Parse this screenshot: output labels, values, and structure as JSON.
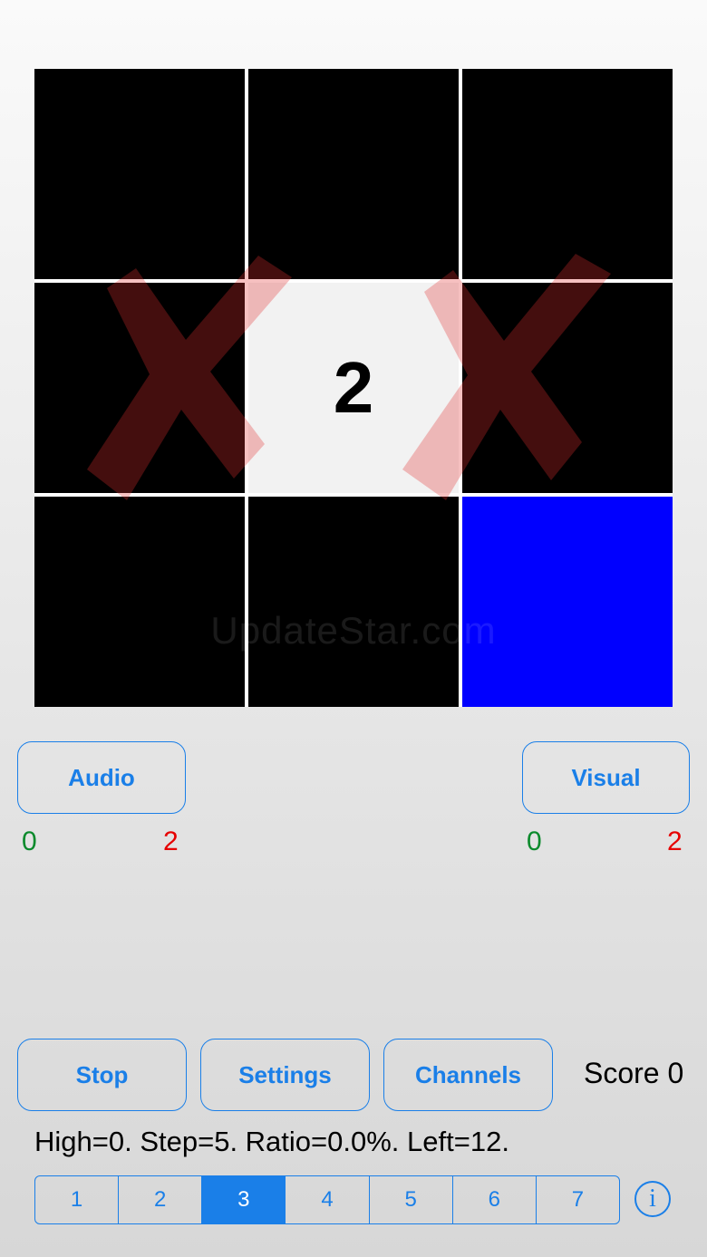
{
  "board": {
    "cells": [
      {
        "state": "off",
        "label": ""
      },
      {
        "state": "off",
        "label": ""
      },
      {
        "state": "off",
        "label": ""
      },
      {
        "state": "off",
        "label": ""
      },
      {
        "state": "lit",
        "label": "2"
      },
      {
        "state": "off",
        "label": ""
      },
      {
        "state": "off",
        "label": ""
      },
      {
        "state": "off",
        "label": ""
      },
      {
        "state": "blue",
        "label": ""
      }
    ],
    "mistake_marks": 2,
    "mark_color": "#e0302e",
    "watermark": "UpdateStar.com"
  },
  "responses": {
    "audio": {
      "label": "Audio",
      "correct": "0",
      "wrong": "2"
    },
    "visual": {
      "label": "Visual",
      "correct": "0",
      "wrong": "2"
    }
  },
  "controls": {
    "stop_label": "Stop",
    "settings_label": "Settings",
    "channels_label": "Channels",
    "score_text": "Score 0"
  },
  "status_text": "High=0. Step=5. Ratio=0.0%. Left=12.",
  "level_selector": {
    "options": [
      "1",
      "2",
      "3",
      "4",
      "5",
      "6",
      "7"
    ],
    "selected": "3"
  },
  "info_icon": "info-icon",
  "colors": {
    "accent": "#1a7fe8",
    "correct": "#0b8a2c",
    "wrong": "#e60000",
    "active_cell": "#0000ff"
  }
}
